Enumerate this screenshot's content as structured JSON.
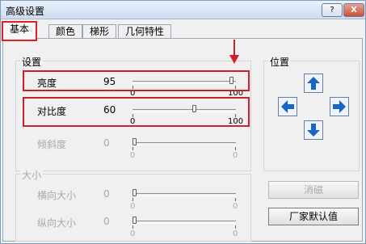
{
  "window": {
    "title": "高级设置",
    "help_label": "?",
    "close_label": "X"
  },
  "tabs": [
    {
      "label": "基本"
    },
    {
      "label": "颜色"
    },
    {
      "label": "梯形"
    },
    {
      "label": "几何特性"
    }
  ],
  "settings_group": {
    "title": "设置",
    "rows": [
      {
        "label": "亮度",
        "value": "95",
        "min": "0",
        "max": "100",
        "enabled": true,
        "position": 0.95
      },
      {
        "label": "对比度",
        "value": "60",
        "min": "0",
        "max": "100",
        "enabled": true,
        "position": 0.6
      },
      {
        "label": "倾斜度",
        "value": "0",
        "min": "0",
        "max": "0",
        "enabled": false,
        "position": 0
      }
    ]
  },
  "size_group": {
    "title": "大小",
    "rows": [
      {
        "label": "横向大小",
        "value": "0",
        "min": "0",
        "max": "0",
        "enabled": false,
        "position": 0
      },
      {
        "label": "纵向大小",
        "value": "0",
        "min": "0",
        "max": "0",
        "enabled": false,
        "position": 0
      }
    ]
  },
  "position_group": {
    "title": "位置"
  },
  "buttons": {
    "cancel_label": "消磁",
    "factory_default_label": "厂家默认值"
  },
  "colors": {
    "annotation_red": "#d11f2a",
    "arrow_blue": "#1666c9"
  },
  "icons": [
    "help-icon",
    "close-icon",
    "arrow-up-icon",
    "arrow-left-icon",
    "arrow-right-icon",
    "arrow-down-icon",
    "annotation-arrow-icon"
  ]
}
